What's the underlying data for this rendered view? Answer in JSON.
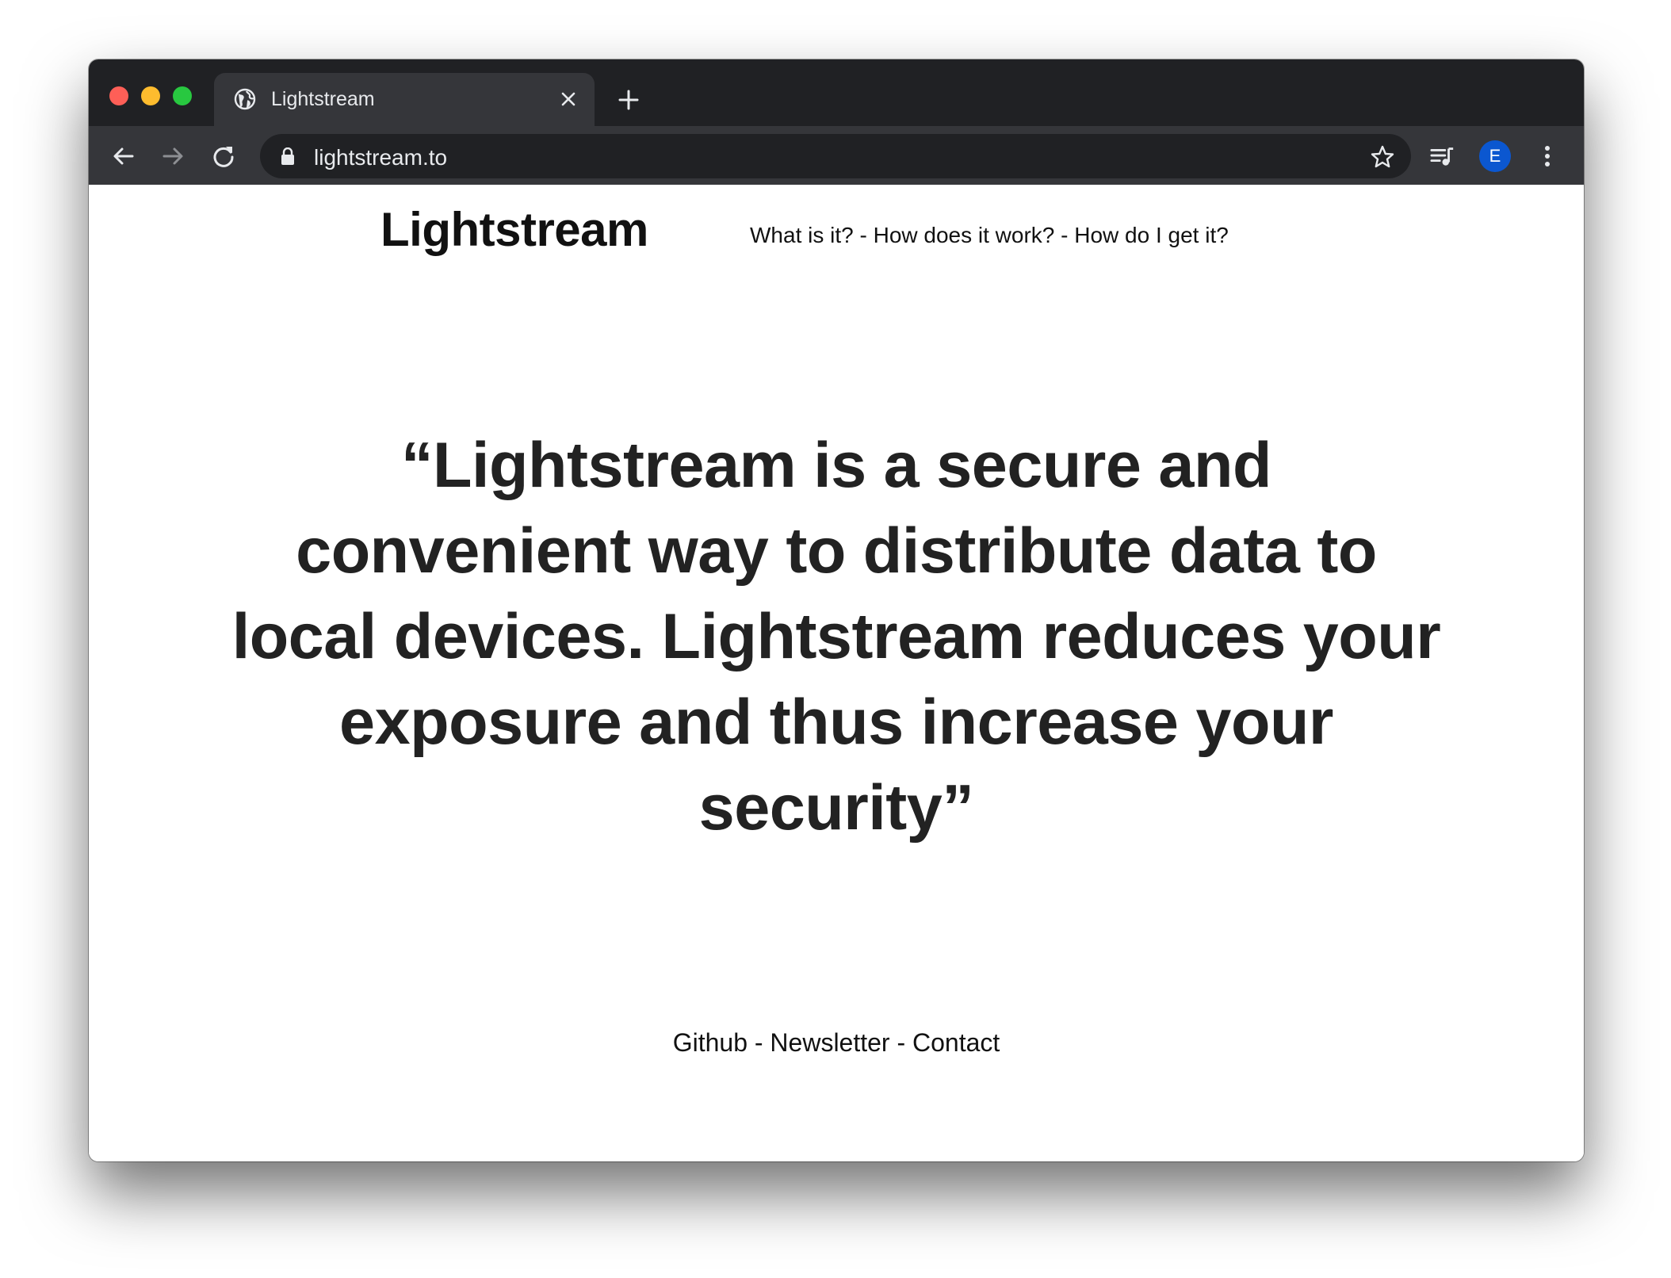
{
  "browser": {
    "tab_title": "Lightstream",
    "url": "lightstream.to",
    "profile_initial": "E"
  },
  "site": {
    "title": "Lightstream",
    "nav": [
      "What is it?",
      "How does it work?",
      "How do I get it?"
    ],
    "nav_separator": " - ",
    "quote_lines": [
      "“Lightstream is a secure and",
      "convenient way to distribute data to",
      "local devices. Lightstream reduces your",
      "exposure and thus increase your",
      "security”"
    ],
    "footer_links": [
      "Github",
      "Newsletter",
      "Contact"
    ]
  },
  "colors": {
    "tabbar_bg": "#202124",
    "toolbar_bg": "#35363a",
    "avatar_bg": "#0b57d0"
  },
  "icons": {
    "favicon": "globe-icon",
    "tab_close": "close-icon",
    "new_tab": "plus-icon",
    "back": "arrow-left-icon",
    "forward": "arrow-right-icon",
    "reload": "reload-icon",
    "lock": "lock-icon",
    "bookmark": "star-icon",
    "media": "media-queue-icon",
    "menu": "kebab-menu-icon"
  }
}
